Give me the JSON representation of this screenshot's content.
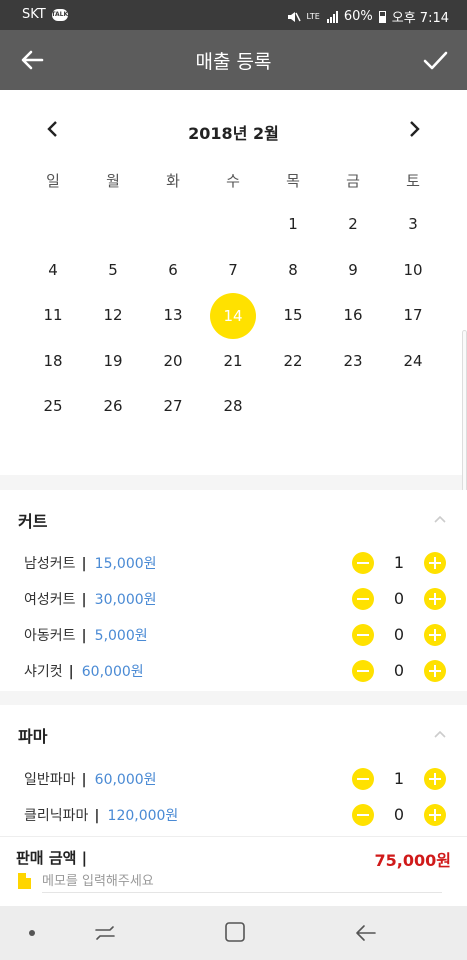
{
  "status": {
    "carrier": "SKT",
    "talk_badge": "TALK",
    "network": "LTE",
    "battery": "60%",
    "time": "오후 7:14"
  },
  "appbar": {
    "title": "매출 등록"
  },
  "calendar": {
    "month_label": "2018년 2월",
    "weekdays": [
      "일",
      "월",
      "화",
      "수",
      "목",
      "금",
      "토"
    ],
    "weeks": [
      [
        "",
        "",
        "",
        "",
        "1",
        "2",
        "3"
      ],
      [
        "4",
        "5",
        "6",
        "7",
        "8",
        "9",
        "10"
      ],
      [
        "11",
        "12",
        "13",
        "14",
        "15",
        "16",
        "17"
      ],
      [
        "18",
        "19",
        "20",
        "21",
        "22",
        "23",
        "24"
      ],
      [
        "25",
        "26",
        "27",
        "28",
        "",
        "",
        ""
      ]
    ],
    "selected_day": "14",
    "selected_color": "#ffe100"
  },
  "sections": [
    {
      "title": "커트",
      "items": [
        {
          "name": "남성커트",
          "price": "15,000원",
          "qty": "1"
        },
        {
          "name": "여성커트",
          "price": "30,000원",
          "qty": "0"
        },
        {
          "name": "아동커트",
          "price": "5,000원",
          "qty": "0"
        },
        {
          "name": "샤기컷",
          "price": "60,000원",
          "qty": "0"
        }
      ]
    },
    {
      "title": "파마",
      "items": [
        {
          "name": "일반파마",
          "price": "60,000원",
          "qty": "1"
        },
        {
          "name": "클리닉파마",
          "price": "120,000원",
          "qty": "0"
        }
      ]
    }
  ],
  "sale": {
    "label": "판매 금액 |",
    "amount": "75,000원",
    "memo_placeholder": "메모를 입력해주세요"
  },
  "colors": {
    "accent": "#ffe100",
    "price": "#4a8ad4",
    "amount": "#d01a1a",
    "appbar": "#5c5c5c"
  }
}
